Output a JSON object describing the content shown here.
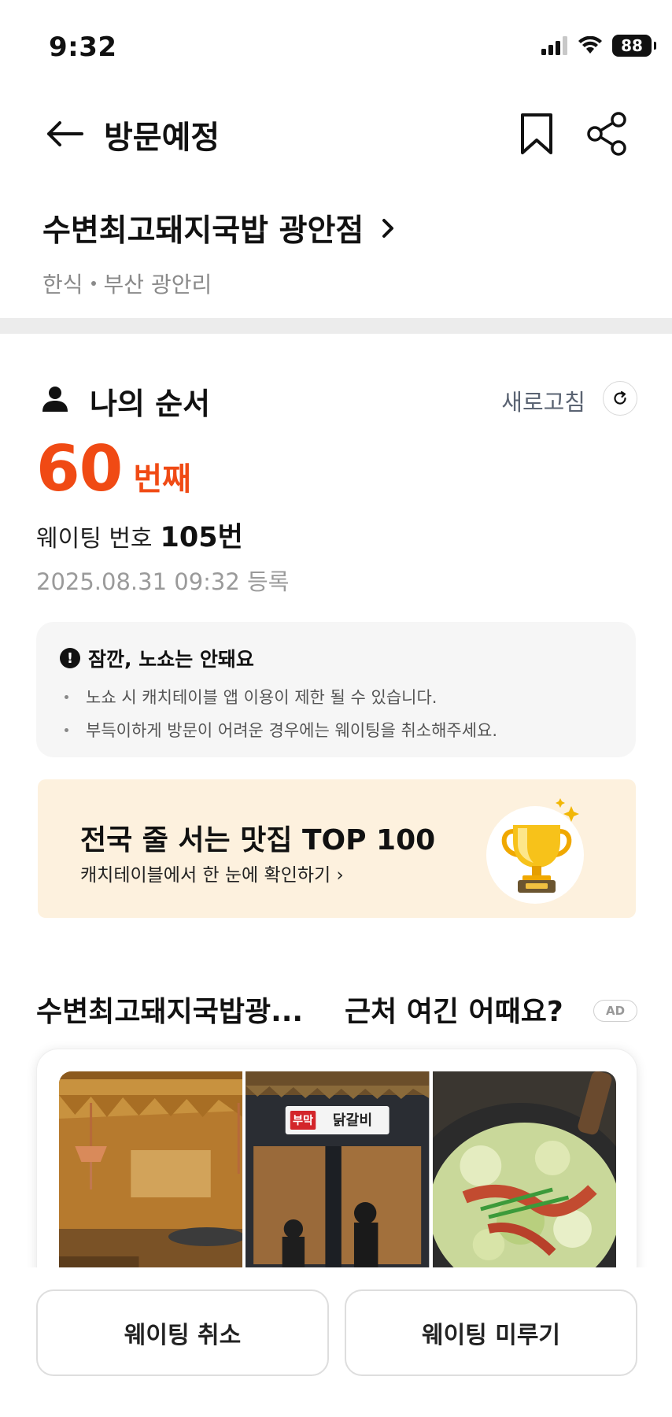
{
  "status_bar": {
    "time": "9:32",
    "battery": "88"
  },
  "nav": {
    "title": "방문예정"
  },
  "store": {
    "name": "수변최고돼지국밥 광안점",
    "category": "한식",
    "area": "부산 광안리"
  },
  "queue": {
    "title": "나의 순서",
    "refresh_label": "새로고침",
    "position_number": "60",
    "position_suffix": "번째",
    "waiting_label": "웨이팅 번호",
    "waiting_number": "105번",
    "registered_at": "2025.08.31 09:32 등록"
  },
  "notice": {
    "title": "잠깐, 노쇼는 안돼요",
    "items": [
      "노쇼 시 캐치테이블 앱 이용이 제한 될 수 있습니다.",
      "부득이하게 방문이 어려운 경우에는 웨이팅을 취소해주세요."
    ]
  },
  "promo": {
    "title": "전국 줄 서는 맛집 TOP 100",
    "subtitle": "캐치테이블에서 한 눈에 확인하기 ›"
  },
  "recommendation": {
    "store": "수변최고돼지국밥광...",
    "title": "근처 여긴 어때요?",
    "ad_label": "AD",
    "sign_red": "부막",
    "sign_main": "닭갈비"
  },
  "actions": {
    "cancel": "웨이팅 취소",
    "postpone": "웨이팅 미루기"
  },
  "colors": {
    "accent": "#f04a14",
    "promo_bg": "#fdf1de",
    "notice_bg": "#f6f6f6"
  }
}
